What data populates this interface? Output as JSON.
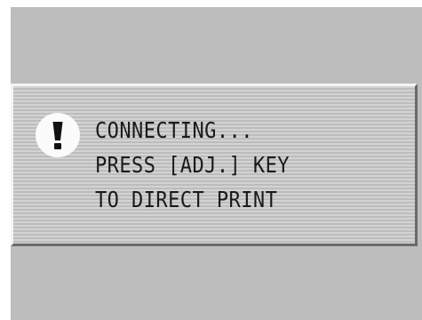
{
  "dialog": {
    "icon": "exclamation-icon",
    "lines": [
      "CONNECTING...",
      "PRESS [ADJ.] KEY",
      "TO DIRECT PRINT"
    ]
  },
  "colors": {
    "screen_background": "#bdbdbd",
    "dialog_background": "#c6c6c6",
    "text": "#1a1a1a",
    "icon_background": "#fbfbfb"
  }
}
